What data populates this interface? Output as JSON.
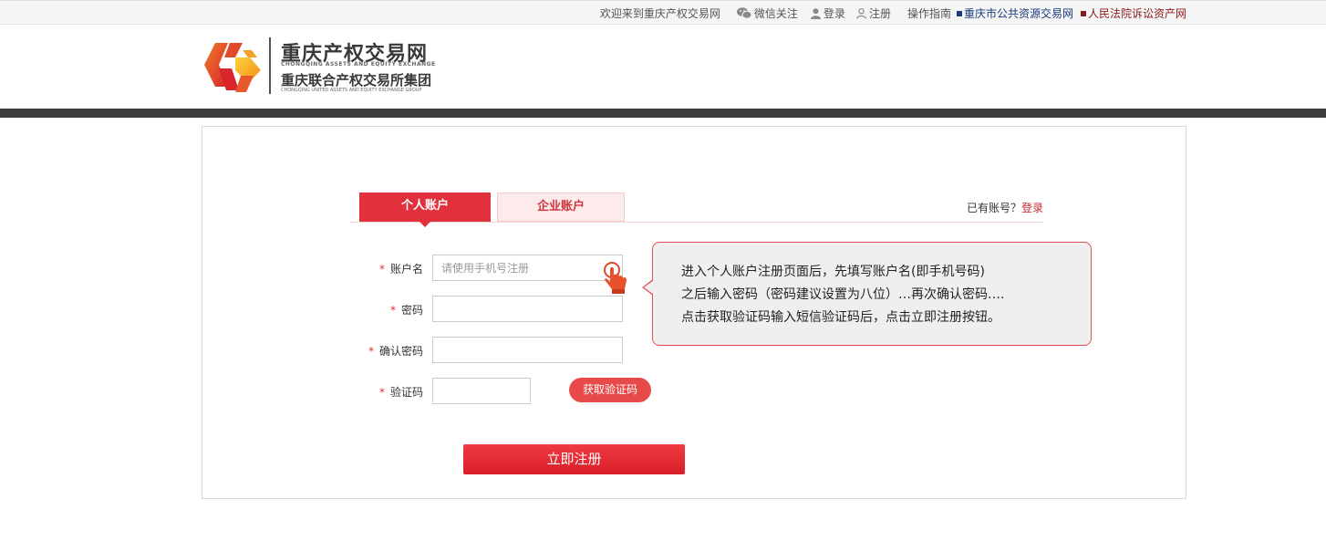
{
  "topbar": {
    "welcome": "欢迎来到重庆产权交易网",
    "wechat": "微信关注",
    "login": "登录",
    "register": "注册",
    "guide": "操作指南",
    "public_resource": "重庆市公共资源交易网",
    "court_assets": "人民法院诉讼资产网"
  },
  "logo": {
    "name_cn": "重庆产权交易网",
    "name_en": "CHONGQING ASSETS AND EQUITY EXCHANGE",
    "group_cn": "重庆联合产权交易所集团",
    "group_en": "CHONGQING UNITED ASSETS AND EQUITY EXCHANGE GROUP"
  },
  "tabs": {
    "personal": "个人账户",
    "company": "企业账户",
    "have_account": "已有账号？",
    "login_link": "登录"
  },
  "form": {
    "username_label": "账户名",
    "username_placeholder": "请使用手机号注册",
    "password_label": "密码",
    "confirm_label": "确认密码",
    "code_label": "验证码",
    "required_mark": "*",
    "get_code": "获取验证码",
    "submit": "立即注册"
  },
  "tooltip": {
    "line1": "进入个人账户注册页面后，先填写账户名(即手机号码)",
    "line2": "之后输入密码（密码建议设置为八位）…再次确认密码….",
    "line3": "点击获取验证码输入短信验证码后，点击立即注册按钮。"
  },
  "colors": {
    "accent": "#e1313c",
    "tab_inactive_bg": "#fdeaea",
    "dark_bar": "#3d3d3d"
  },
  "icons": [
    "wechat-icon",
    "user-icon",
    "register-user-icon",
    "pointing-hand-icon",
    "logo-mark"
  ]
}
